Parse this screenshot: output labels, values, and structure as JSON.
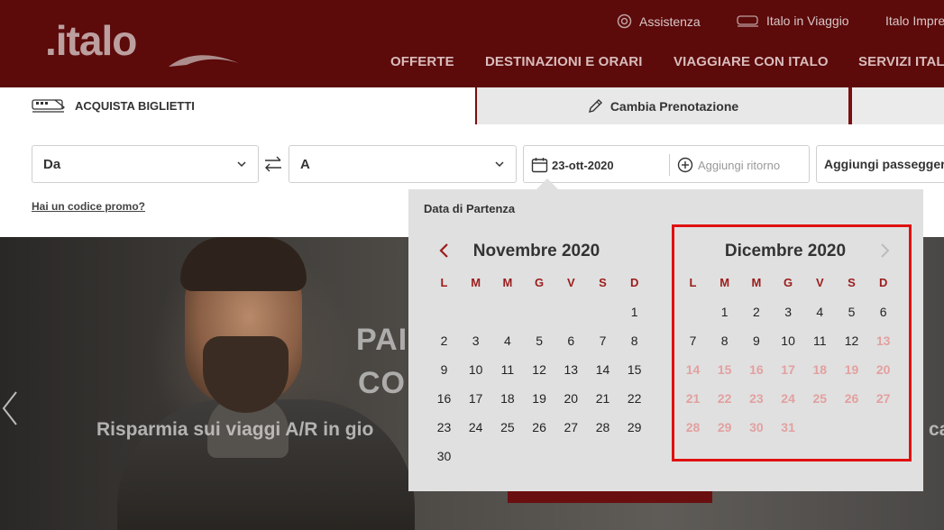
{
  "brand": {
    "logo_text": ".italo"
  },
  "header": {
    "utility_links": [
      {
        "label": "Assistenza",
        "icon": "lifebuoy-icon"
      },
      {
        "label": "Italo in Viaggio",
        "icon": "train-icon"
      },
      {
        "label": "Italo Impre"
      }
    ],
    "nav": [
      "OFFERTE",
      "DESTINAZIONI E ORARI",
      "VIAGGIARE CON ITALO",
      "SERVIZI ITAL"
    ]
  },
  "tabs": {
    "buy": "ACQUISTA BIGLIETTI",
    "change": "Cambia Prenotazione"
  },
  "search": {
    "from": "Da",
    "to": "A",
    "date": "23-ott-2020",
    "return_placeholder": "Aggiungi ritorno",
    "passengers": "Aggiungi passeggeri",
    "promo": "Hai un codice promo?"
  },
  "hero": {
    "title_line1": "PAI",
    "title_line2": "CO",
    "subtitle": "Risparmia sui viaggi A/R in gio",
    "subtitle_right": "ca"
  },
  "calendar": {
    "label": "Data di Partenza",
    "weekdays": [
      "L",
      "M",
      "M",
      "G",
      "V",
      "S",
      "D"
    ],
    "months": [
      {
        "title": "Novembre 2020",
        "first_weekday": 6,
        "days": 30,
        "disabled_from": 0
      },
      {
        "title": "Dicembre 2020",
        "first_weekday": 1,
        "days": 31,
        "disabled_from": 13
      }
    ]
  },
  "colors": {
    "brand": "#5c0a0a",
    "accent": "#9b1c1c",
    "highlight": "#e01010"
  }
}
